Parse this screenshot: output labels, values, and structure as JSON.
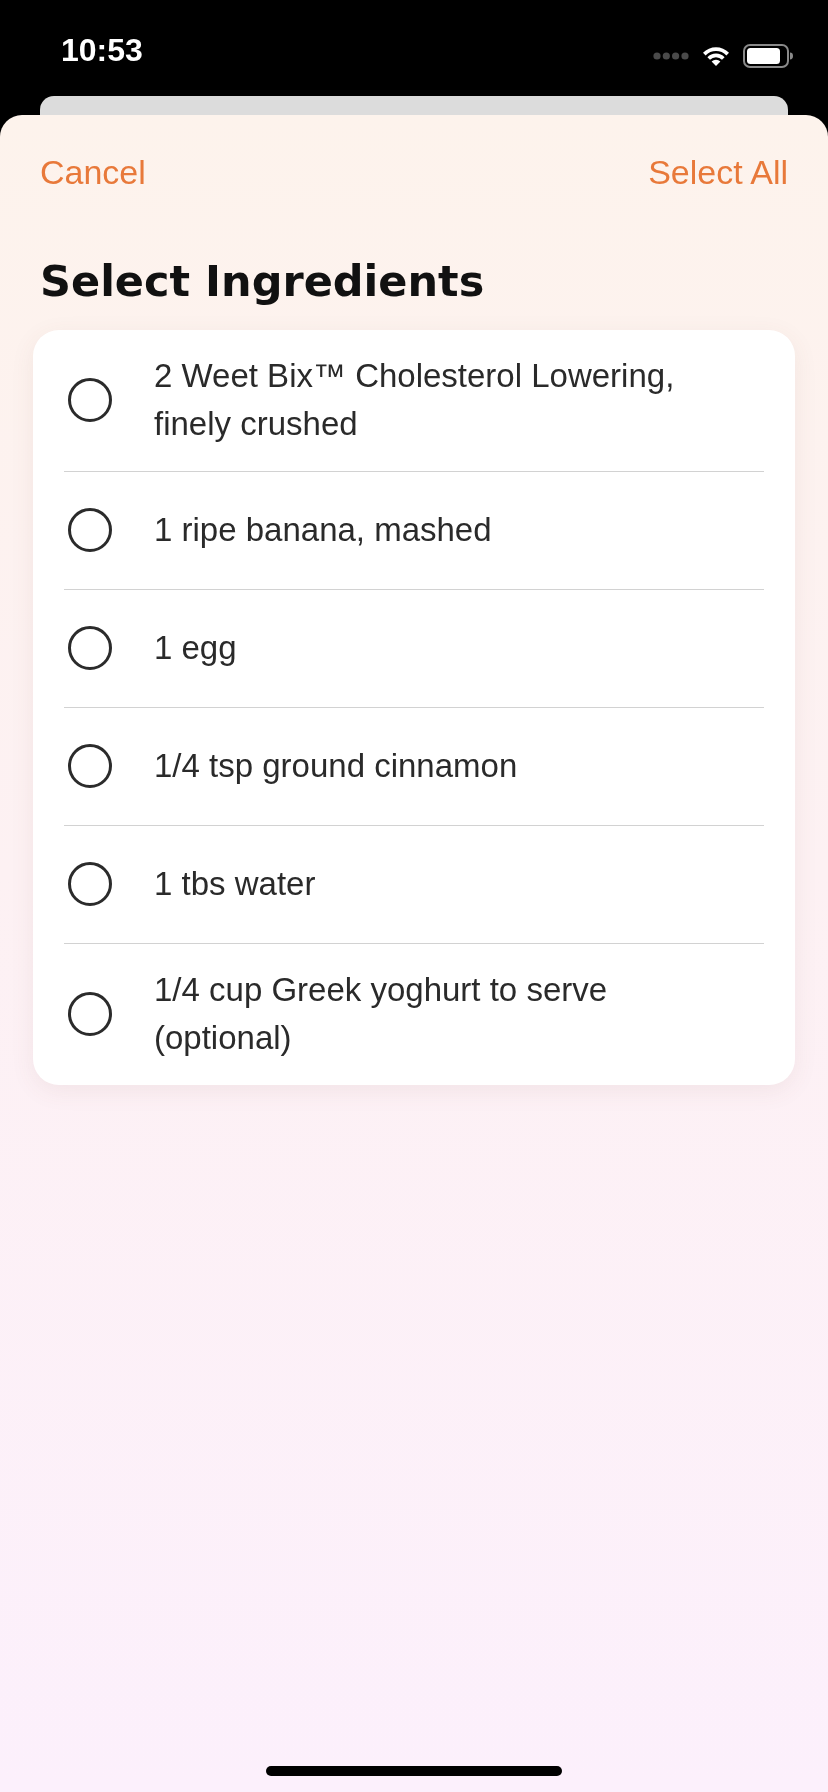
{
  "status_bar": {
    "time": "10:53"
  },
  "header": {
    "cancel": "Cancel",
    "select_all": "Select All"
  },
  "title": "Select Ingredients",
  "ingredients": [
    {
      "text": "2 Weet Bix™ Cholesterol Lowering, finely crushed",
      "selected": false
    },
    {
      "text": "1 ripe banana, mashed",
      "selected": false
    },
    {
      "text": "1 egg",
      "selected": false
    },
    {
      "text": "1/4 tsp ground cinnamon",
      "selected": false
    },
    {
      "text": "1 tbs water",
      "selected": false
    },
    {
      "text": "1/4 cup Greek yoghurt to serve (optional)",
      "selected": false
    }
  ]
}
